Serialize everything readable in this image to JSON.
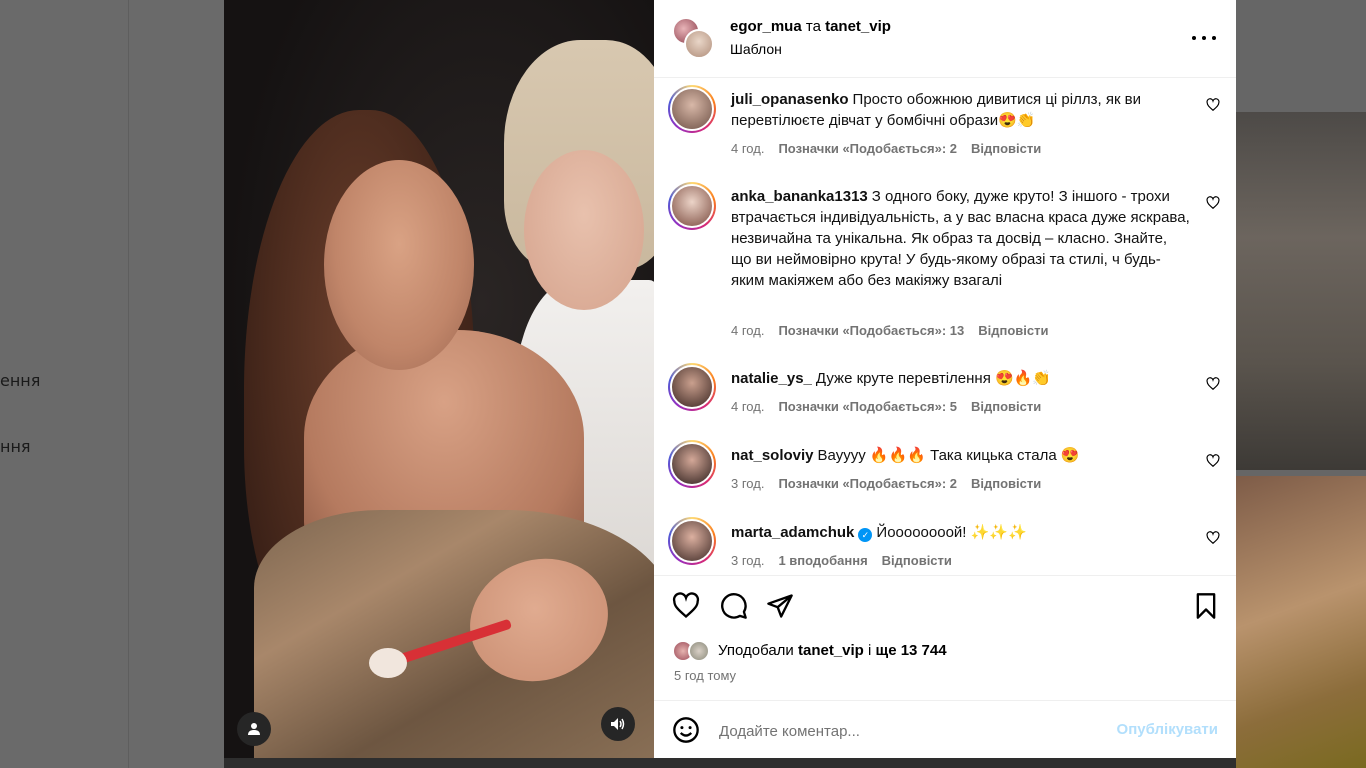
{
  "background": {
    "nav_items": [
      "ення",
      "ння"
    ]
  },
  "post": {
    "author": "egor_mua",
    "connector": "та",
    "coauthor": "tanet_vip",
    "subtitle": "Шаблон"
  },
  "comments": [
    {
      "user": "juli_opanasenko",
      "text": "Просто обожнюю дивитися ці ріллз, як ви перевтілюєте дівчат у бомбічні образи😍👏",
      "time": "4 год.",
      "likes": "Позначки «Подобається»: 2",
      "reply": "Відповісти",
      "verified": false
    },
    {
      "user": "anka_bananka1313",
      "text": "З одного боку, дуже круто! З іншого - трохи втрачається індивідуальність, а у вас власна краса дуже яскрава, незвичайна та унікальна. Як образ та досвід – класно. Знайте, що ви неймовірно крута! У будь-якому образі та стилі, ч будь-яким макіяжем або без макіяжу взагалі",
      "time": "4 год.",
      "likes": "Позначки «Подобається»: 13",
      "reply": "Відповісти",
      "verified": false
    },
    {
      "user": "natalie_ys_",
      "text": "Дуже круте перевтілення 😍🔥👏",
      "time": "4 год.",
      "likes": "Позначки «Подобається»: 5",
      "reply": "Відповісти",
      "verified": false
    },
    {
      "user": "nat_soloviy",
      "text": "Вауууу 🔥🔥🔥 Така кицька стала 😍",
      "time": "3 год.",
      "likes": "Позначки «Подобається»: 2",
      "reply": "Відповісти",
      "verified": false
    },
    {
      "user": "marta_adamchuk",
      "text": "Йоооооооой! ✨✨✨",
      "time": "3 год.",
      "likes": "1 вподобання",
      "reply": "Відповісти",
      "verified": true
    }
  ],
  "likes": {
    "prefix": "Уподобали",
    "user": "tanet_vip",
    "connector": "і",
    "others": "ще 13 744"
  },
  "timestamp": "5 год тому",
  "comment_box": {
    "placeholder": "Додайте коментар...",
    "post_label": "Опублікувати"
  },
  "colors": {
    "link_blue": "#0095f6",
    "post_disabled": "#b2dffc",
    "meta_gray": "#737373"
  }
}
